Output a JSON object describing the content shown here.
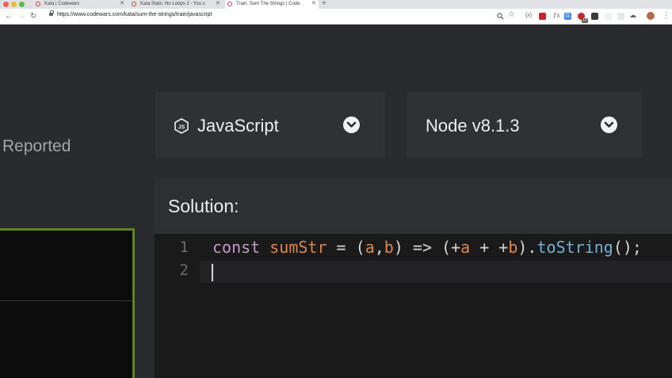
{
  "browser": {
    "tabs": [
      {
        "title": "Kata | Codewars",
        "active": false
      },
      {
        "title": "Kata Stats: No Loops 2 - You c",
        "active": false
      },
      {
        "title": "Train: Sum The Strings | Code",
        "active": true
      }
    ],
    "url": "https://www.codewars.com/kata/sum-the-strings/train/javascript",
    "extension_badge": "10"
  },
  "page": {
    "sidebar_heading": "Reported",
    "language_select": {
      "value": "JavaScript",
      "icon": "nodejs-icon"
    },
    "version_select": {
      "value": "Node v8.1.3"
    },
    "solution": {
      "title": "Solution:",
      "line_numbers": [
        "1",
        "2"
      ],
      "code": {
        "kw": "const",
        "name": "sumStr",
        "eq": " = (",
        "p1": "a",
        "comma": ",",
        "p2": "b",
        "arrow": ") => (+",
        "p3": "a",
        "plus": " + +",
        "p4": "b",
        "dot": ").",
        "method": "toString",
        "end": "();"
      }
    }
  },
  "colors": {
    "accent_border": "#5d8228",
    "keyword": "#c39ac9",
    "function": "#e0864a",
    "method": "#72b0d8"
  }
}
